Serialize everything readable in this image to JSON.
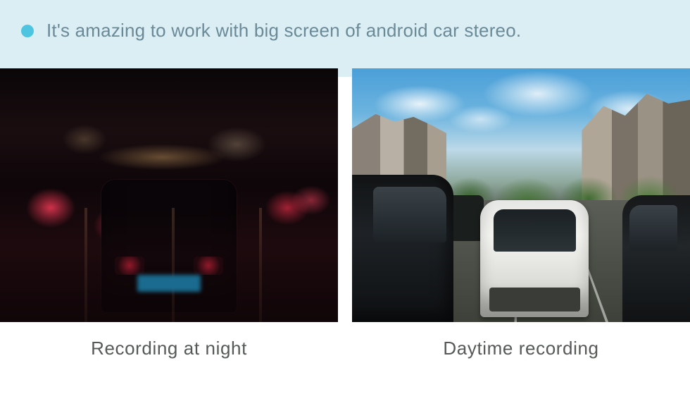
{
  "header": {
    "headline": "It's amazing to work with big screen of android car stereo."
  },
  "panels": {
    "left_caption": "Recording at night",
    "right_caption": "Daytime recording"
  },
  "colors": {
    "header_bg": "#daeef4",
    "bullet": "#4dc5e0",
    "headline_text": "#6b8a97",
    "caption_text": "#555a56"
  }
}
